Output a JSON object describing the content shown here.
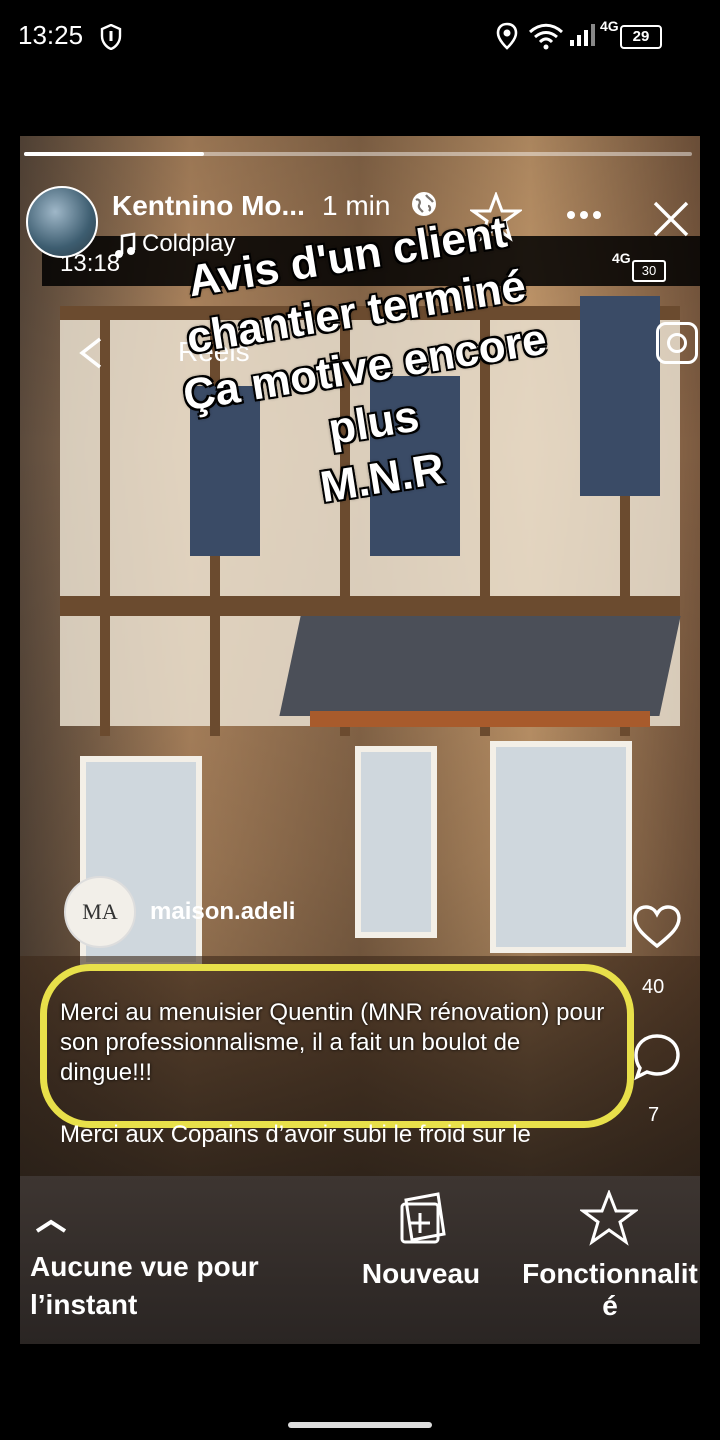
{
  "status_bar": {
    "time": "13:25",
    "battery": "29",
    "network": "4G"
  },
  "story": {
    "progress": 0.27,
    "author": "Kentnino Mo...",
    "age": "1 min",
    "music": "Coldplay",
    "overlay_lines": [
      "Avis d'un client",
      "chantier terminé",
      "Ça motive encore",
      "plus",
      "M.N.R"
    ],
    "inner_status": {
      "time": "13:18",
      "network": "4G",
      "battery": "30"
    },
    "reels_label": "Reels",
    "post": {
      "brand_initials": "MA",
      "brand_name": "maison.adeli",
      "review_highlighted": "Merci au menuisier Quentin (MNR rénovation) pour son professionnalisme, il a fait un boulot de dingue!!!",
      "review_next": "Merci aux Copains d’avoir subi le froid sur le",
      "likes": "40",
      "comments": "7"
    }
  },
  "bottom_bar": {
    "views_label": "Aucune vue pour l’instant",
    "new_label": "Nouveau",
    "feature_label": "Fonctionnalité"
  },
  "colors": {
    "highlight": "#e8e04a",
    "bar_bg": "#2a2523"
  }
}
